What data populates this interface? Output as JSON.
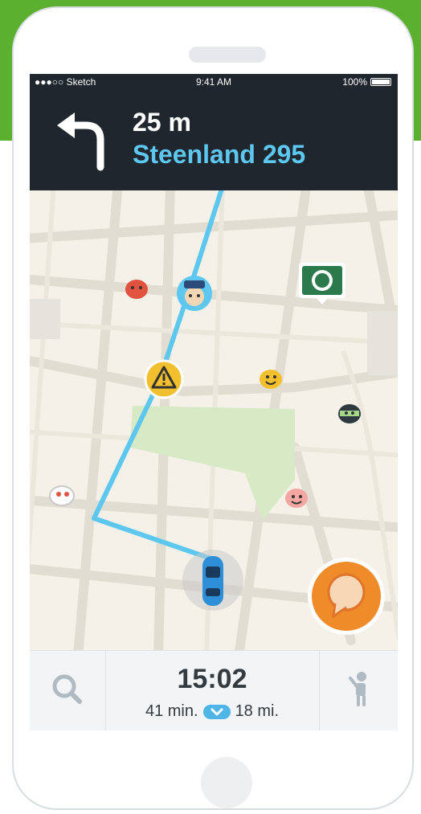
{
  "status_bar": {
    "carrier": "●●●○○ Sketch",
    "time": "9:41 AM",
    "battery": "100%"
  },
  "navigation": {
    "distance": "25 m",
    "street": "Steenland 295",
    "turn_icon": "turn-left-arrow"
  },
  "map": {
    "route_color": "#5ec7f0",
    "markers": [
      "police-icon",
      "hazard-icon",
      "starbucks-icon",
      "wazer-icons",
      "car-icon"
    ]
  },
  "bottom_bar": {
    "eta_time": "15:02",
    "duration": "41 min.",
    "distance": "18 mi."
  },
  "colors": {
    "brand_green": "#5bb12f",
    "header_dark": "#1f262d",
    "accent_blue": "#5ec7f0",
    "report_orange": "#f08b2a"
  }
}
